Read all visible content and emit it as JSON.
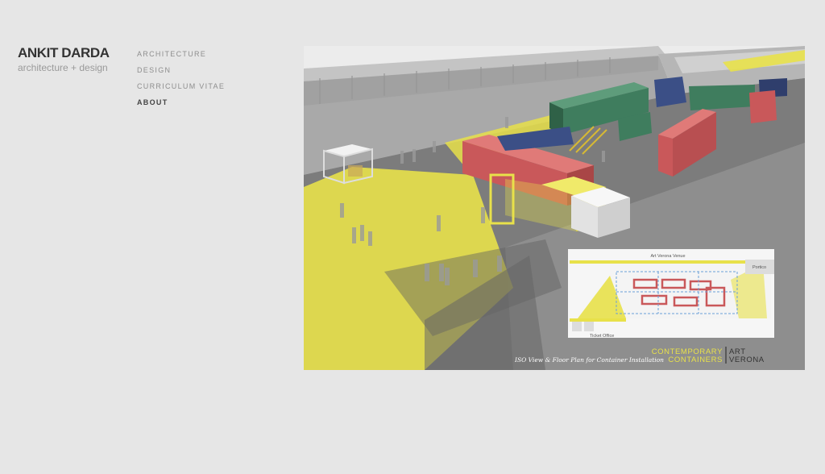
{
  "brand": {
    "name": "ANKIT DARDA",
    "tagline": "architecture + design"
  },
  "nav": {
    "items": [
      {
        "label": "ARCHITECTURE",
        "active": false
      },
      {
        "label": "DESIGN",
        "active": false
      },
      {
        "label": "CURRICULUM VITAE",
        "active": false
      },
      {
        "label": "ABOUT",
        "active": true
      }
    ]
  },
  "hero": {
    "caption": "ISO View & Floor Plan for Container Installation",
    "title_line1": "CONTEMPORARY",
    "title_line2": "CONTAINERS",
    "art_line1": "ART",
    "art_line2": "VERONA",
    "plan": {
      "venue_label": "Art Verona Venue",
      "portico_label": "Portico",
      "ticket_label": "Ticket Office"
    }
  },
  "colors": {
    "page_bg": "#e6e6e6",
    "brand_dark": "#333333",
    "nav_grey": "#8e8e8e",
    "accent_yellow": "#e8e14a",
    "container_red": "#c9585a",
    "container_green": "#3f7d5e",
    "container_blue": "#3b4f86"
  }
}
